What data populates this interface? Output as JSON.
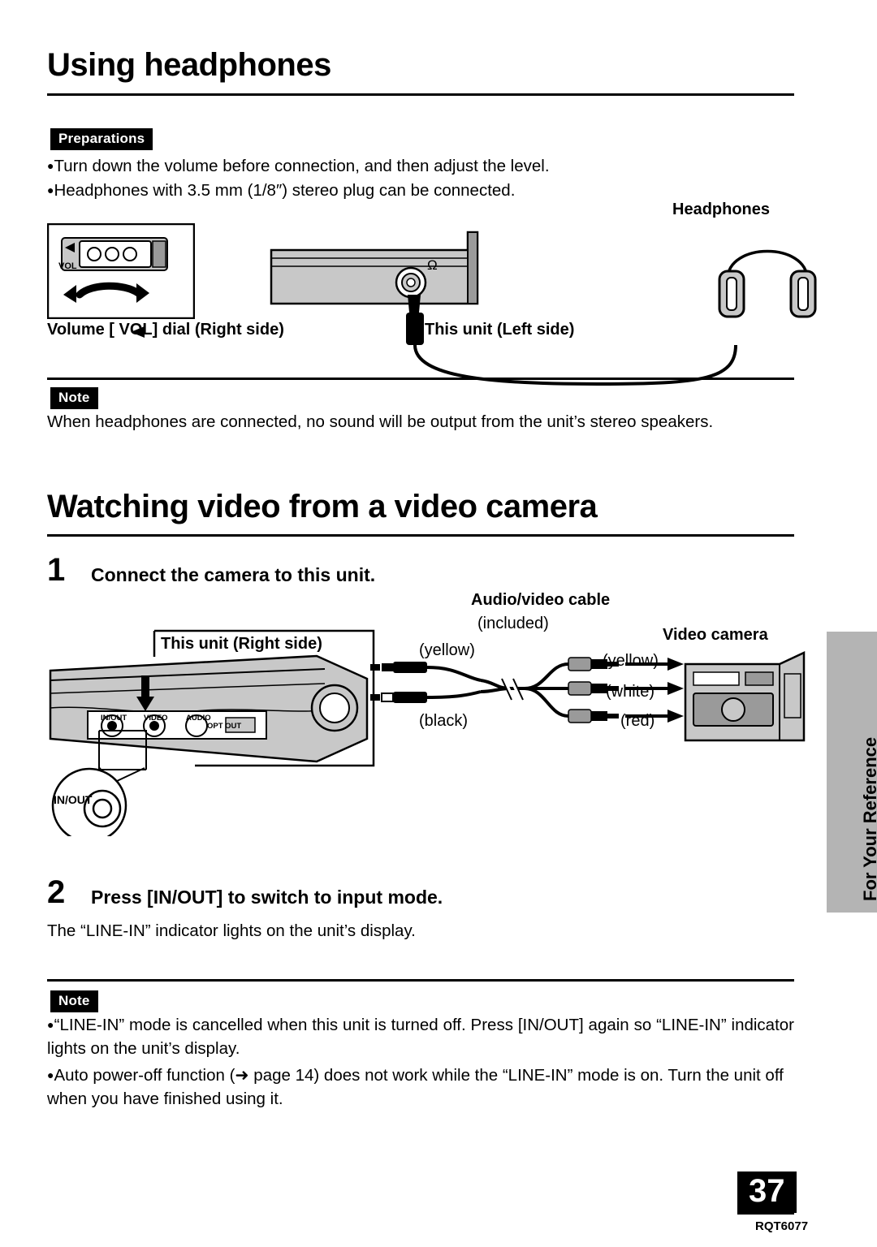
{
  "page": {
    "number": "37",
    "doc_code": "RQT6077",
    "side_tab": "For Your Reference"
  },
  "section1": {
    "title": "Using headphones",
    "prep_tag": "Preparations",
    "prep_items": [
      "Turn down the volume before connection, and then adjust the level.",
      "Headphones with 3.5 mm (1/8″) stereo plug can be connected."
    ],
    "labels": {
      "headphones": "Headphones",
      "volume_dial": "Volume [    VOL] dial (Right side)",
      "unit_left": "This unit (Left side)",
      "vol_icon": "VOL",
      "phone_jack": "Ω"
    },
    "note_tag": "Note",
    "note_text": "When headphones are connected, no sound will be output from the unit’s stereo speakers."
  },
  "section2": {
    "title": "Watching video from a video camera",
    "step1": {
      "num": "1",
      "text": "Connect the camera to this unit."
    },
    "step2": {
      "num": "2",
      "text": "Press [IN/OUT] to switch to input mode."
    },
    "step2_body": "The “LINE-IN” indicator lights on the unit’s display.",
    "labels": {
      "unit_right": "This unit (Right side)",
      "cable_title": "Audio/video cable",
      "cable_sub": "(included)",
      "video_camera": "Video camera",
      "left_yellow": "(yellow)",
      "left_black": "(black)",
      "right_yellow": "(yellow)",
      "right_white": "(white)",
      "right_red": "(red)",
      "port_inout": "IN/OUT",
      "port_video": "VIDEO",
      "port_audio": "AUDIO",
      "port_optout": "OPT OUT",
      "callout_inout": "IN/OUT"
    },
    "note_tag": "Note",
    "note_items": [
      "“LINE-IN” mode is cancelled when this unit is turned off. Press [IN/OUT] again so “LINE-IN” indicator lights on the unit’s display.",
      "Auto power-off function (➜ page 14) does not work while the “LINE-IN” mode is on. Turn the unit off when you have finished using it."
    ]
  },
  "colors": {
    "tab_gray": "#b4b4b4",
    "art_gray": "#c8c8c8",
    "art_gray_dark": "#9a9a9a",
    "black": "#000000"
  }
}
